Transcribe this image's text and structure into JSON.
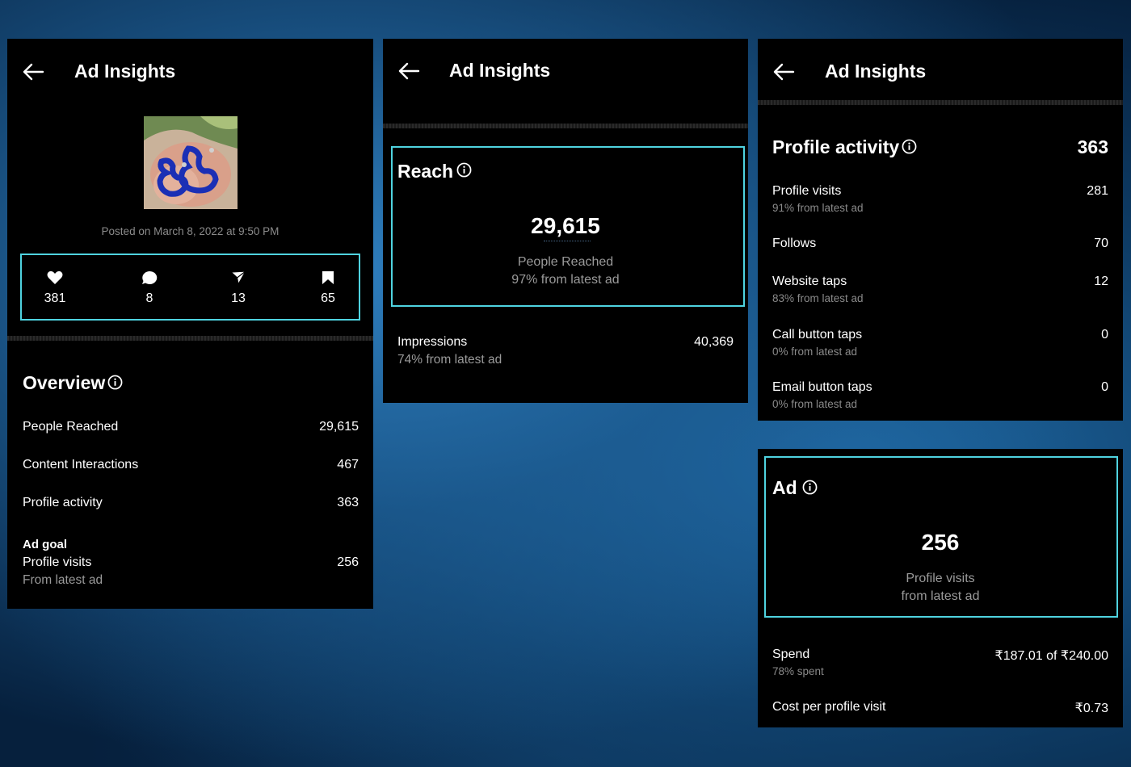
{
  "colors": {
    "highlight": "#4fd3e0",
    "panel_bg": "#000000",
    "muted_text": "#8a8a8a",
    "page_bg": "#114777"
  },
  "panel1": {
    "title": "Ad Insights",
    "posted": "Posted on March 8, 2022 at 9:50 PM",
    "stats": [
      {
        "icon": "heart-icon",
        "value": "381"
      },
      {
        "icon": "comment-icon",
        "value": "8"
      },
      {
        "icon": "share-icon",
        "value": "13"
      },
      {
        "icon": "bookmark-icon",
        "value": "65"
      }
    ],
    "overview_title": "Overview",
    "rows": [
      {
        "label": "People Reached",
        "value": "29,615"
      },
      {
        "label": "Content Interactions",
        "value": "467"
      },
      {
        "label": "Profile activity",
        "value": "363"
      }
    ],
    "ad_goal_label": "Ad goal",
    "ad_goal_metric": "Profile visits",
    "ad_goal_value": "256",
    "ad_goal_sub": "From latest ad"
  },
  "panel2": {
    "title": "Ad Insights",
    "reach_title": "Reach",
    "reach_value": "29,615",
    "reach_label": "People Reached",
    "reach_sub": "97% from latest ad",
    "impressions_label": "Impressions",
    "impressions_sub": "74% from latest ad",
    "impressions_value": "40,369"
  },
  "panel3": {
    "title": "Ad Insights",
    "profile_activity_title": "Profile activity",
    "profile_activity_value": "363",
    "rows": [
      {
        "label": "Profile visits",
        "sub": "91% from latest ad",
        "value": "281"
      },
      {
        "label": "Follows",
        "sub": "",
        "value": "70"
      },
      {
        "label": "Website taps",
        "sub": "83% from latest ad",
        "value": "12"
      },
      {
        "label": "Call button taps",
        "sub": "0% from latest ad",
        "value": "0"
      },
      {
        "label": "Email button taps",
        "sub": "0% from latest ad",
        "value": "0"
      }
    ]
  },
  "panel4": {
    "ad_title": "Ad",
    "ad_value": "256",
    "ad_label": "Profile visits",
    "ad_sub": "from latest ad",
    "spend_label": "Spend",
    "spend_sub": "78% spent",
    "spend_value": "₹187.01 of ₹240.00",
    "cpv_label": "Cost per profile visit",
    "cpv_value": "₹0.73"
  }
}
